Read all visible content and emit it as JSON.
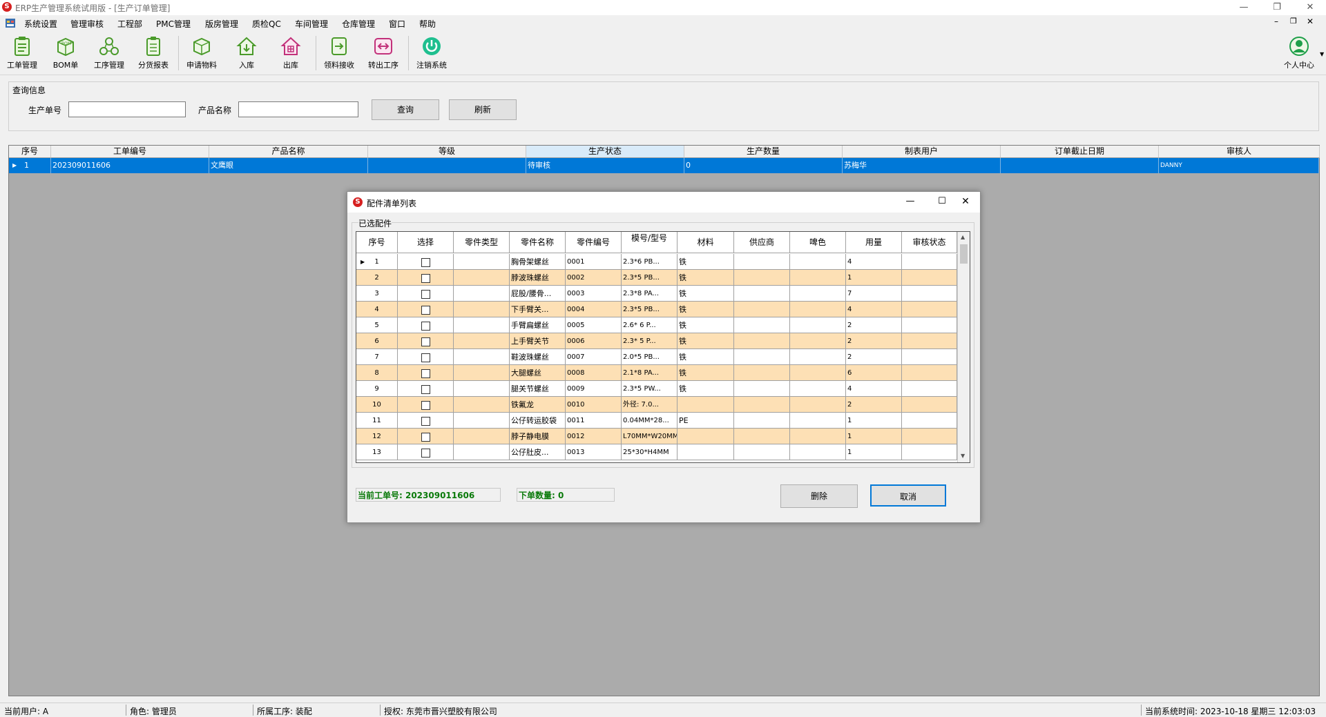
{
  "window": {
    "title": "ERP生产管理系统试用版 - [生产订单管理]",
    "logo_text": "S",
    "controls": {
      "minimize": "—",
      "restore": "❐",
      "close": "✕"
    },
    "mdi_controls": {
      "minimize": "–",
      "restore": "❐",
      "close": "✕"
    }
  },
  "menu": [
    "系统设置",
    "管理审核",
    "工程部",
    "PMC管理",
    "版房管理",
    "质检QC",
    "车间管理",
    "仓库管理",
    "窗口",
    "帮助"
  ],
  "toolbar": {
    "buttons": [
      {
        "label": "工单管理",
        "icon": "clipboard-icon"
      },
      {
        "label": "BOM单",
        "icon": "bom-box-icon"
      },
      {
        "label": "工序管理",
        "icon": "process-icon"
      },
      {
        "label": "分货报表",
        "icon": "report-icon"
      },
      {
        "label": "申请物料",
        "icon": "package-icon"
      },
      {
        "label": "入库",
        "icon": "warehouse-in-icon"
      },
      {
        "label": "出库",
        "icon": "warehouse-out-icon"
      },
      {
        "label": "领料接收",
        "icon": "receive-icon"
      },
      {
        "label": "转出工序",
        "icon": "transfer-icon"
      },
      {
        "label": "注销系统",
        "icon": "power-icon"
      }
    ],
    "user_center": "个人中心"
  },
  "query": {
    "group_title": "查询信息",
    "order_no_label": "生产单号",
    "order_no_value": "",
    "product_label": "产品名称",
    "product_value": "",
    "search_btn": "查询",
    "refresh_btn": "刷新"
  },
  "main_grid": {
    "headers": [
      "序号",
      "工单编号",
      "产品名称",
      "等级",
      "生产状态",
      "生产数量",
      "制表用户",
      "订单截止日期",
      "审核人"
    ],
    "rows": [
      {
        "seq": "1",
        "order_no": "202309011606",
        "product": "文鹰眼",
        "grade": "",
        "status": "待审核",
        "qty": "0",
        "user": "苏梅华",
        "deadline": "",
        "auditor": "DANNY"
      }
    ]
  },
  "dialog": {
    "title": "配件清单列表",
    "group_title": "已选配件",
    "headers": [
      "序号",
      "选择",
      "零件类型",
      "零件名称",
      "零件编号",
      "模号/型号",
      "材料",
      "供应商",
      "啤色",
      "用量",
      "审核状态"
    ],
    "rows": [
      {
        "seq": "1",
        "checked": false,
        "type": "",
        "name": "胸骨架螺丝",
        "code": "0001",
        "model": "2.3*6  PB...",
        "material": "铁",
        "supplier": "",
        "color": "",
        "qty": "4",
        "audit": ""
      },
      {
        "seq": "2",
        "checked": false,
        "type": "",
        "name": "脖波珠螺丝",
        "code": "0002",
        "model": "2.3*5  PB...",
        "material": "铁",
        "supplier": "",
        "color": "",
        "qty": "1",
        "audit": ""
      },
      {
        "seq": "3",
        "checked": false,
        "type": "",
        "name": "屁股/腰骨...",
        "code": "0003",
        "model": "2.3*8  PA...",
        "material": "铁",
        "supplier": "",
        "color": "",
        "qty": "7",
        "audit": ""
      },
      {
        "seq": "4",
        "checked": false,
        "type": "",
        "name": "下手臂关...",
        "code": "0004",
        "model": "2.3*5  PB...",
        "material": "铁",
        "supplier": "",
        "color": "",
        "qty": "4",
        "audit": ""
      },
      {
        "seq": "5",
        "checked": false,
        "type": "",
        "name": "手臂扁螺丝",
        "code": "0005",
        "model": "2.6* 6  P...",
        "material": "铁",
        "supplier": "",
        "color": "",
        "qty": "2",
        "audit": ""
      },
      {
        "seq": "6",
        "checked": false,
        "type": "",
        "name": "上手臂关节",
        "code": "0006",
        "model": "2.3* 5  P...",
        "material": "铁",
        "supplier": "",
        "color": "",
        "qty": "2",
        "audit": ""
      },
      {
        "seq": "7",
        "checked": false,
        "type": "",
        "name": "鞋波珠螺丝",
        "code": "0007",
        "model": "2.0*5  PB...",
        "material": "铁",
        "supplier": "",
        "color": "",
        "qty": "2",
        "audit": ""
      },
      {
        "seq": "8",
        "checked": false,
        "type": "",
        "name": "大腿螺丝",
        "code": "0008",
        "model": "2.1*8  PA...",
        "material": "铁",
        "supplier": "",
        "color": "",
        "qty": "6",
        "audit": ""
      },
      {
        "seq": "9",
        "checked": false,
        "type": "",
        "name": "腿关节螺丝",
        "code": "0009",
        "model": "2.3*5  PW...",
        "material": "铁",
        "supplier": "",
        "color": "",
        "qty": "4",
        "audit": ""
      },
      {
        "seq": "10",
        "checked": false,
        "type": "",
        "name": "铁氟龙",
        "code": "0010",
        "model": "外径: 7.0...",
        "material": "",
        "supplier": "",
        "color": "",
        "qty": "2",
        "audit": ""
      },
      {
        "seq": "11",
        "checked": false,
        "type": "",
        "name": "公仔转运胶袋",
        "code": "0011",
        "model": "0.04MM*28...",
        "material": "PE",
        "supplier": "",
        "color": "",
        "qty": "1",
        "audit": ""
      },
      {
        "seq": "12",
        "checked": false,
        "type": "",
        "name": "脖子静电膜",
        "code": "0012",
        "model": "L70MM*W20MM",
        "material": "",
        "supplier": "",
        "color": "",
        "qty": "1",
        "audit": ""
      },
      {
        "seq": "13",
        "checked": false,
        "type": "",
        "name": "公仔肚皮...",
        "code": "0013",
        "model": "25*30*H4MM",
        "material": "",
        "supplier": "",
        "color": "",
        "qty": "1",
        "audit": ""
      }
    ],
    "current_order_label": "当前工单号: 202309011606",
    "order_qty_label": "下单数量: 0",
    "delete_btn": "删除",
    "cancel_btn": "取消"
  },
  "status_bar": {
    "user": "当前用户: A",
    "role": "角色: 管理员",
    "process": "所属工序: 装配",
    "license": "授权: 东莞市晋兴塑胶有限公司",
    "time": "当前系统时间: 2023-10-18 星期三 12:03:03"
  },
  "colors": {
    "selected_row": "#0078d7",
    "alt_row": "#fde0b5",
    "info_text": "#0a7a0a",
    "grid_bg": "#ababab"
  }
}
